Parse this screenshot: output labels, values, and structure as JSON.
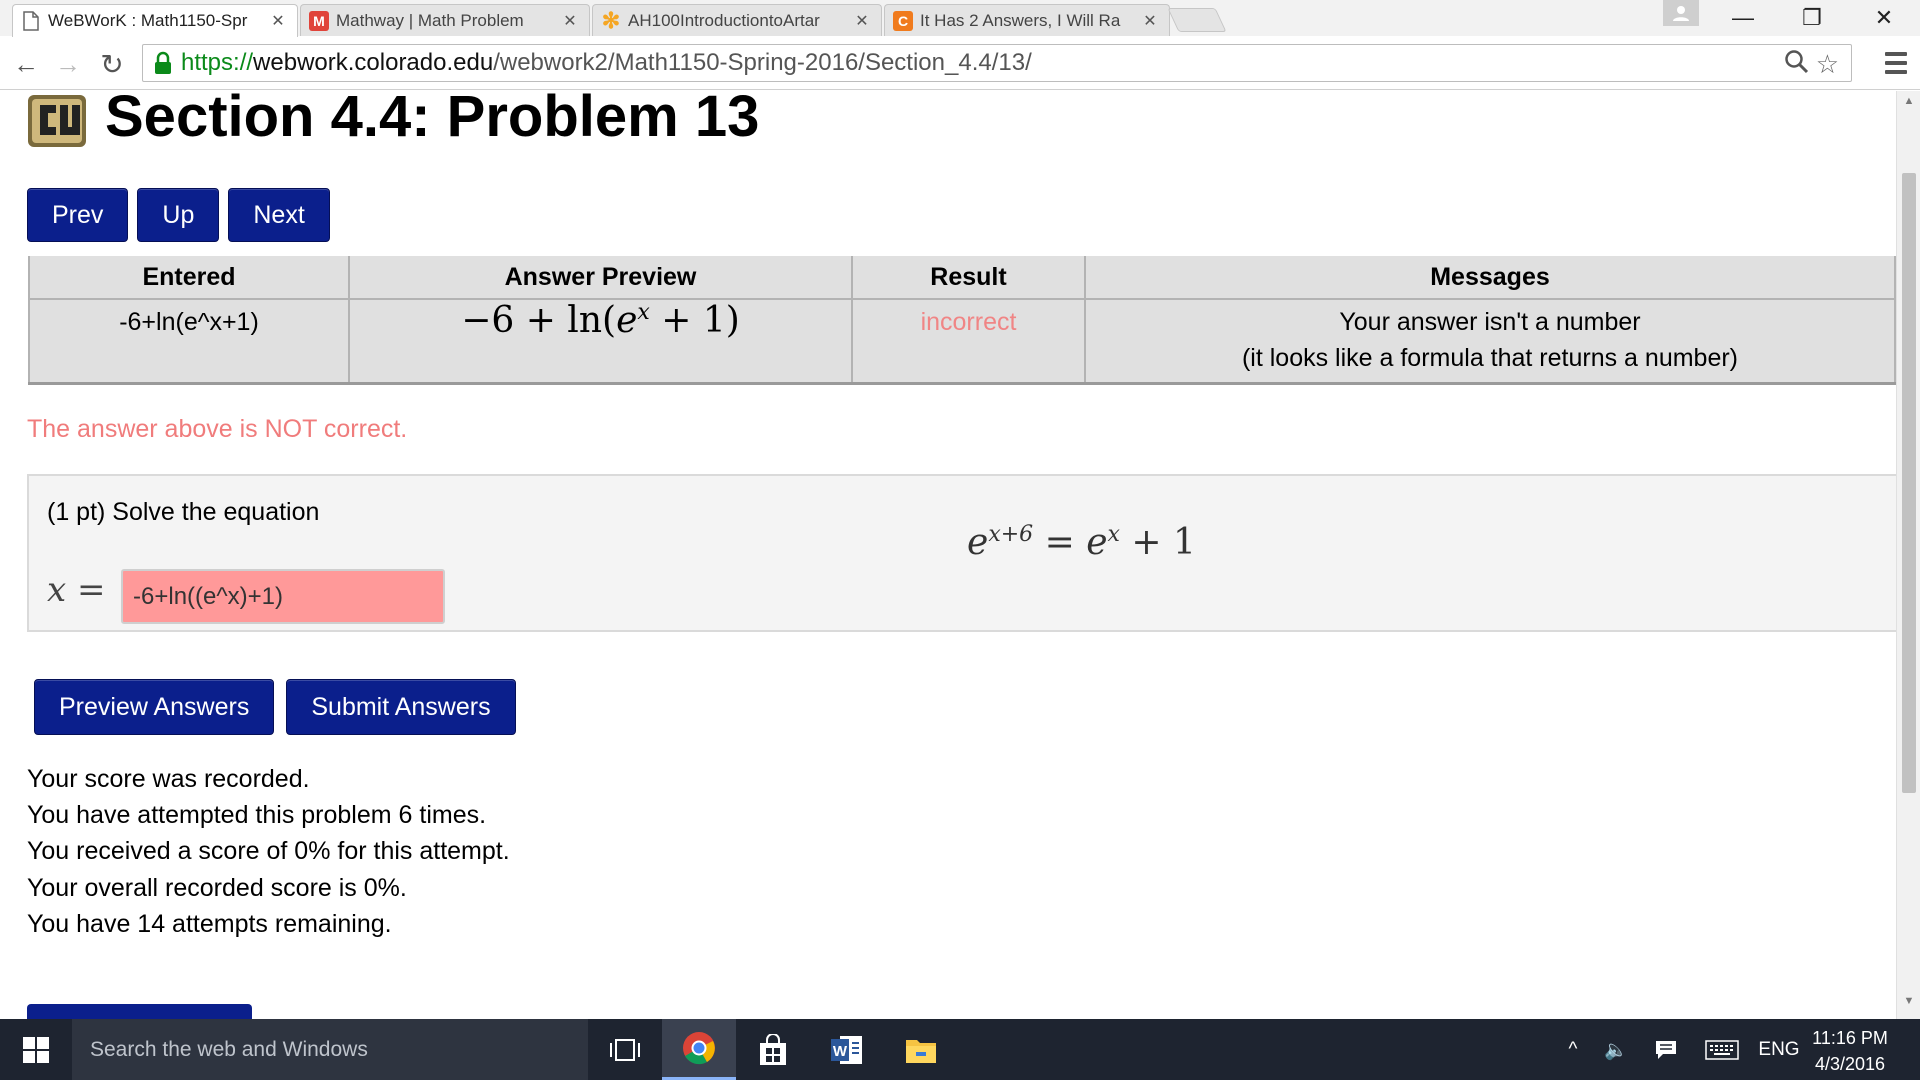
{
  "browser": {
    "tabs": [
      {
        "title": "WeBWorK : Math1150-Spr",
        "active": true,
        "favicon": "page-icon"
      },
      {
        "title": "Mathway | Math Problem",
        "active": false,
        "favicon": "mathway-icon",
        "favicon_letter": "M",
        "favicon_color": "#e0433a"
      },
      {
        "title": "AH100IntroductiontoArtar",
        "active": false,
        "favicon": "flower-icon",
        "favicon_color": "#f5a623"
      },
      {
        "title": "It Has 2 Answers, I Will Ra",
        "active": false,
        "favicon": "chegg-icon",
        "favicon_letter": "C",
        "favicon_color": "#f07b1d"
      }
    ],
    "url": {
      "protocol": "https://",
      "host": "webwork.colorado.edu",
      "path": "/webwork2/Math1150-Spring-2016/Section_4.4/13/"
    }
  },
  "page": {
    "title": "Section 4.4: Problem 13",
    "nav": {
      "prev": "Prev",
      "up": "Up",
      "next": "Next"
    },
    "results_table": {
      "headers": [
        "Entered",
        "Answer Preview",
        "Result",
        "Messages"
      ],
      "row": {
        "entered": "-6+ln(e^x+1)",
        "preview_parts": [
          "−6 + ln(",
          "e",
          "x",
          " + 1)"
        ],
        "result": "incorrect",
        "message_line1": "Your answer isn't a number",
        "message_line2": "(it looks like a formula that returns a number)"
      }
    },
    "verdict": "The answer above is NOT correct.",
    "problem": {
      "statement": "(1 pt) Solve the equation",
      "equation_parts": [
        "e",
        "x+6",
        " = ",
        "e",
        "x",
        " + 1"
      ],
      "variable_label": "x =",
      "answer_value": "-6+ln((e^x)+1)"
    },
    "actions": {
      "preview": "Preview Answers",
      "submit": "Submit Answers"
    },
    "score_lines": [
      "Your score was recorded.",
      "You have attempted this problem 6 times.",
      "You received a score of 0% for this attempt.",
      "Your overall recorded score is 0%.",
      "You have 14 attempts remaining."
    ]
  },
  "taskbar": {
    "search_placeholder": "Search the web and Windows",
    "language": "ENG",
    "time": "11:16 PM",
    "date": "4/3/2016"
  },
  "colors": {
    "button_blue": "#0b1f8c",
    "incorrect_red": "#f08585",
    "answer_box_red": "#ff9999",
    "url_green": "#0b8a1a"
  }
}
